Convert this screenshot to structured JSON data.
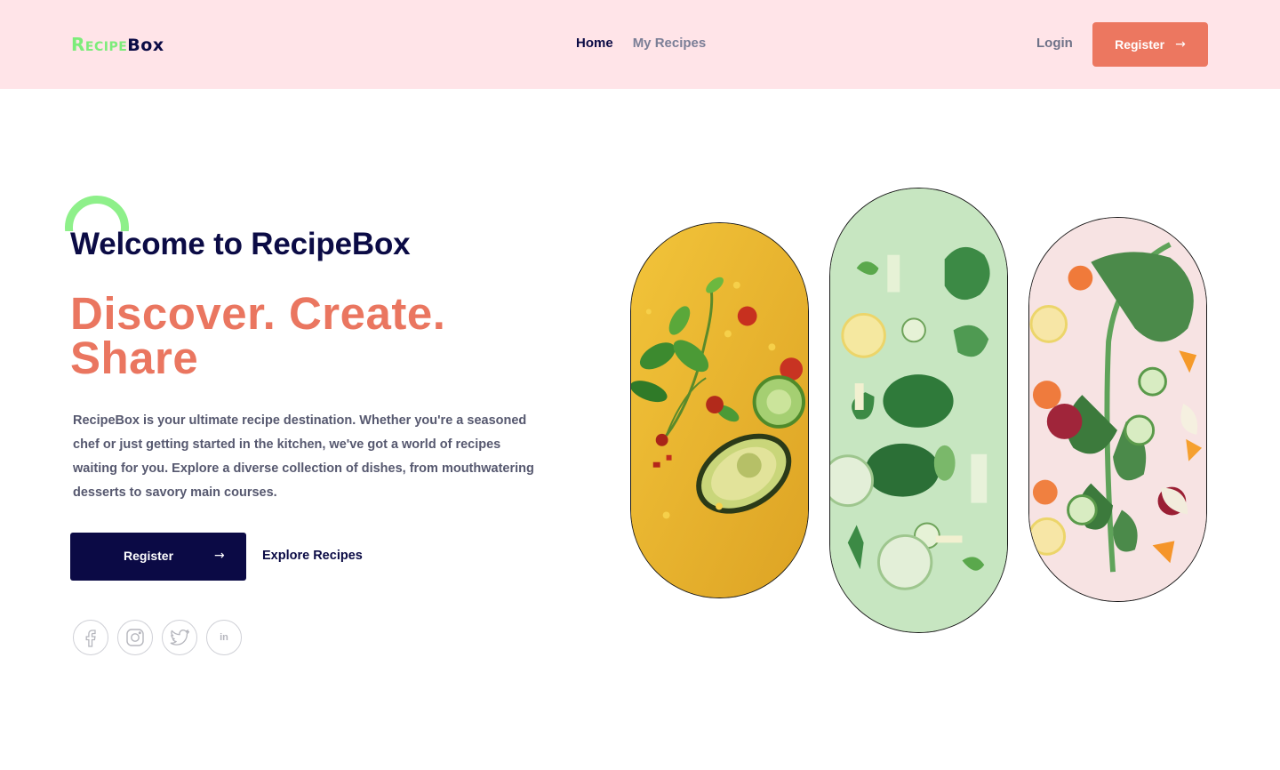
{
  "header": {
    "logo_part1": "Recipe",
    "logo_part2": "Box",
    "nav": [
      {
        "label": "Home",
        "active": true
      },
      {
        "label": "My Recipes",
        "active": false
      }
    ],
    "login_label": "Login",
    "register_label": "Register",
    "register_icon": "arrow-right-icon"
  },
  "hero": {
    "welcome": "Welcome to RecipeBox",
    "tagline": "Discover. Create. Share",
    "description": "RecipeBox is your ultimate recipe destination. Whether you're a seasoned chef or just getting started in the kitchen, we've got a world of recipes waiting for you. Explore a diverse collection of dishes, from mouthwatering desserts to savory main courses.",
    "register_label": "Register",
    "explore_label": "Explore Recipes"
  },
  "socials": [
    {
      "icon": "facebook-icon"
    },
    {
      "icon": "instagram-icon"
    },
    {
      "icon": "twitter-icon"
    },
    {
      "icon": "linkedin-icon",
      "text": "in"
    }
  ],
  "images": [
    {
      "icon": "food-image-avocado-basil"
    },
    {
      "icon": "food-image-greens-flatlay"
    },
    {
      "icon": "food-image-kale-beets"
    }
  ],
  "colors": {
    "header_bg": "#ffe4e8",
    "accent": "#ec7760",
    "navy": "#0b0a45",
    "green": "#8ef08a"
  }
}
